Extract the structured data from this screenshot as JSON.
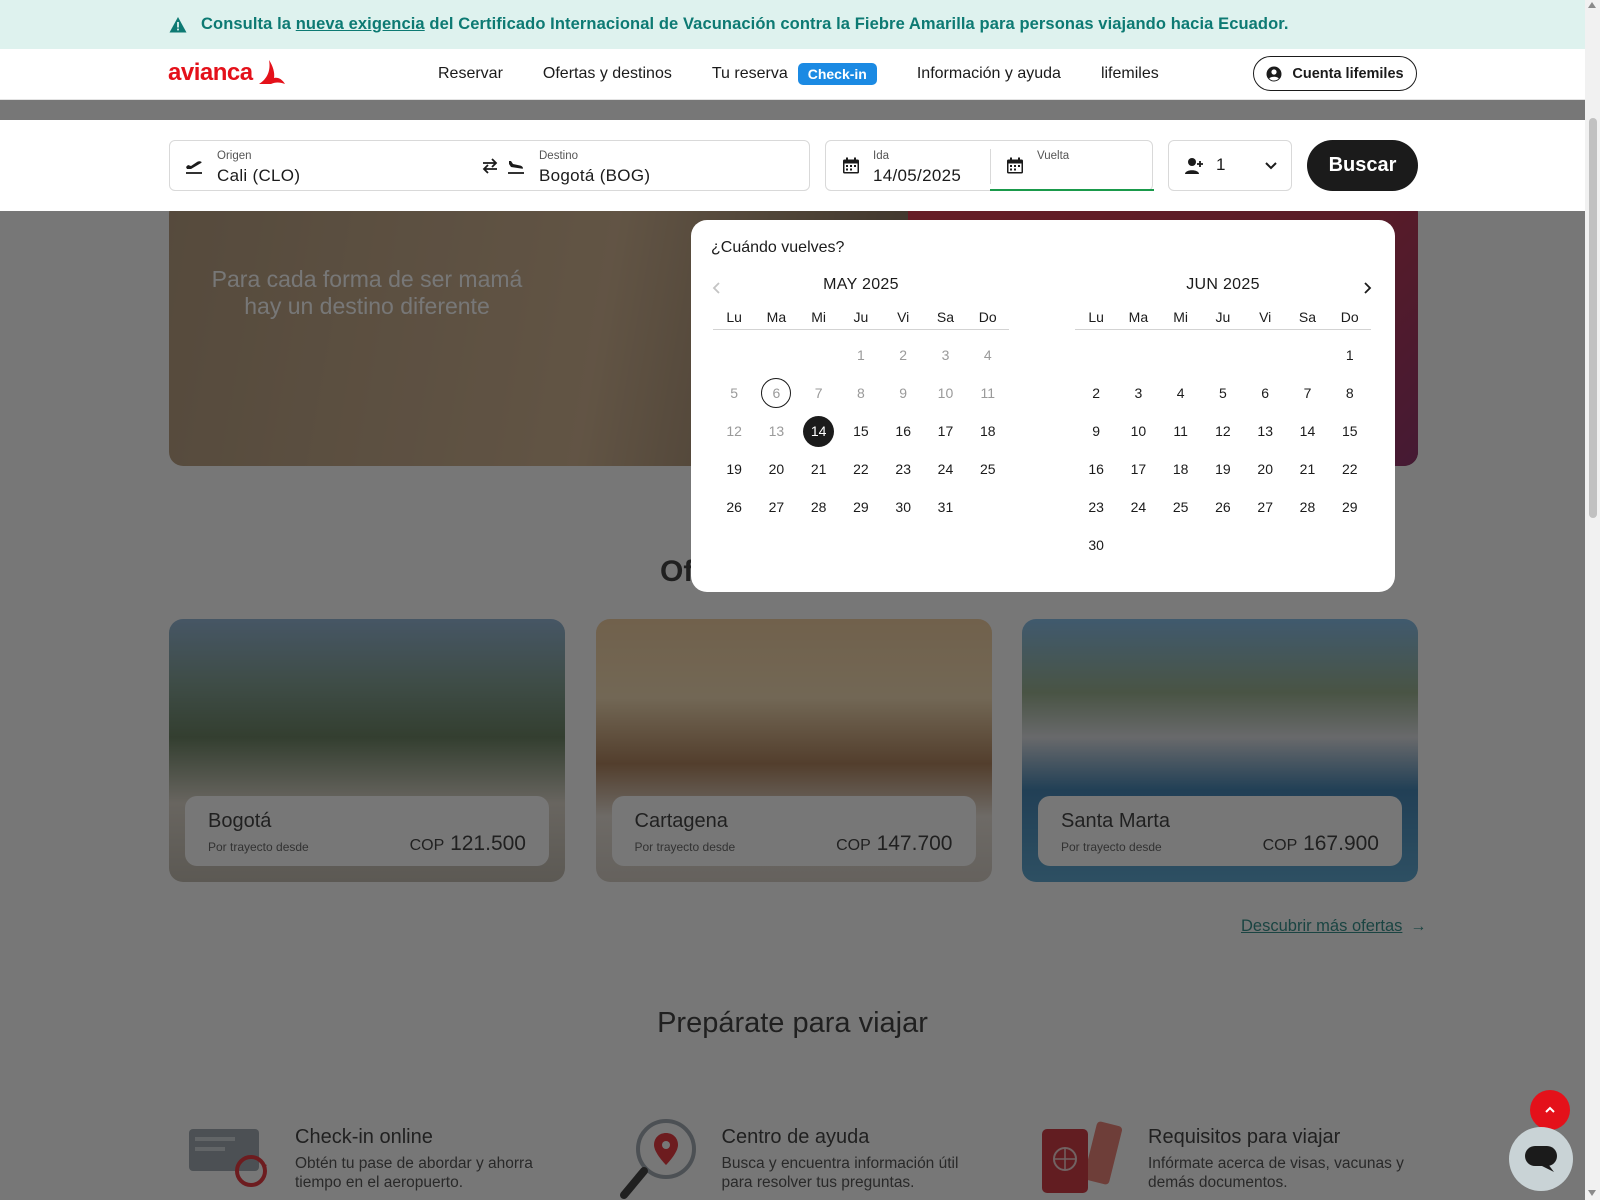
{
  "alert": {
    "text_before": "Consulta la ",
    "link": "nueva exigencia",
    "text_after": " del Certificado Internacional de Vacunación contra la Fiebre Amarilla para personas viajando hacia Ecuador.",
    "icon": "warning-icon"
  },
  "nav": {
    "logo": "avianca",
    "items": [
      "Reservar",
      "Ofertas y destinos",
      "Tu reserva",
      "Información y ayuda",
      "lifemiles"
    ],
    "checkin_badge": "Check-in",
    "account_button": "Cuenta lifemiles"
  },
  "search": {
    "origin_label": "Origen",
    "origin_value": "Cali (CLO)",
    "destination_label": "Destino",
    "destination_value": "Bogotá (BOG)",
    "ida_label": "Ida",
    "ida_value": "14/05/2025",
    "vuelta_label": "Vuelta",
    "vuelta_value": "",
    "passengers": "1",
    "button": "Buscar"
  },
  "hero": {
    "text": "Para cada forma de ser mamá hay un destino diferente"
  },
  "offers": {
    "title_partial": "Of",
    "cards": [
      {
        "city": "Bogotá",
        "sub": "Por trayecto desde",
        "currency": "COP",
        "price": "121.500"
      },
      {
        "city": "Cartagena",
        "sub": "Por trayecto desde",
        "currency": "COP",
        "price": "147.700"
      },
      {
        "city": "Santa Marta",
        "sub": "Por trayecto desde",
        "currency": "COP",
        "price": "167.900"
      }
    ],
    "more_link": "Descubrir más ofertas"
  },
  "prepare": {
    "title": "Prepárate para viajar",
    "cards": [
      {
        "title": "Check-in online",
        "desc": "Obtén tu pase de abordar y ahorra tiempo en el aeropuerto."
      },
      {
        "title": "Centro de ayuda",
        "desc": "Busca y encuentra información útil para resolver tus preguntas."
      },
      {
        "title": "Requisitos para viajar",
        "desc": "Infórmate acerca de visas, vacunas y demás documentos."
      }
    ]
  },
  "calendar": {
    "question": "¿Cuándo vuelves?",
    "weekdays": [
      "Lu",
      "Ma",
      "Mi",
      "Ju",
      "Vi",
      "Sa",
      "Do"
    ],
    "months": [
      {
        "title": "MAY 2025",
        "offset": 3,
        "days": 31,
        "disabled_until": 13,
        "today": 6,
        "selected": 14
      },
      {
        "title": "JUN 2025",
        "offset": 6,
        "days": 30,
        "disabled_until": 0,
        "today": 0,
        "selected": 0
      }
    ]
  },
  "colors": {
    "brand_red": "#e4111a",
    "alert_teal": "#0d7a73",
    "checkin_blue": "#1b8ae3",
    "selection_green": "#1a9a4b"
  }
}
